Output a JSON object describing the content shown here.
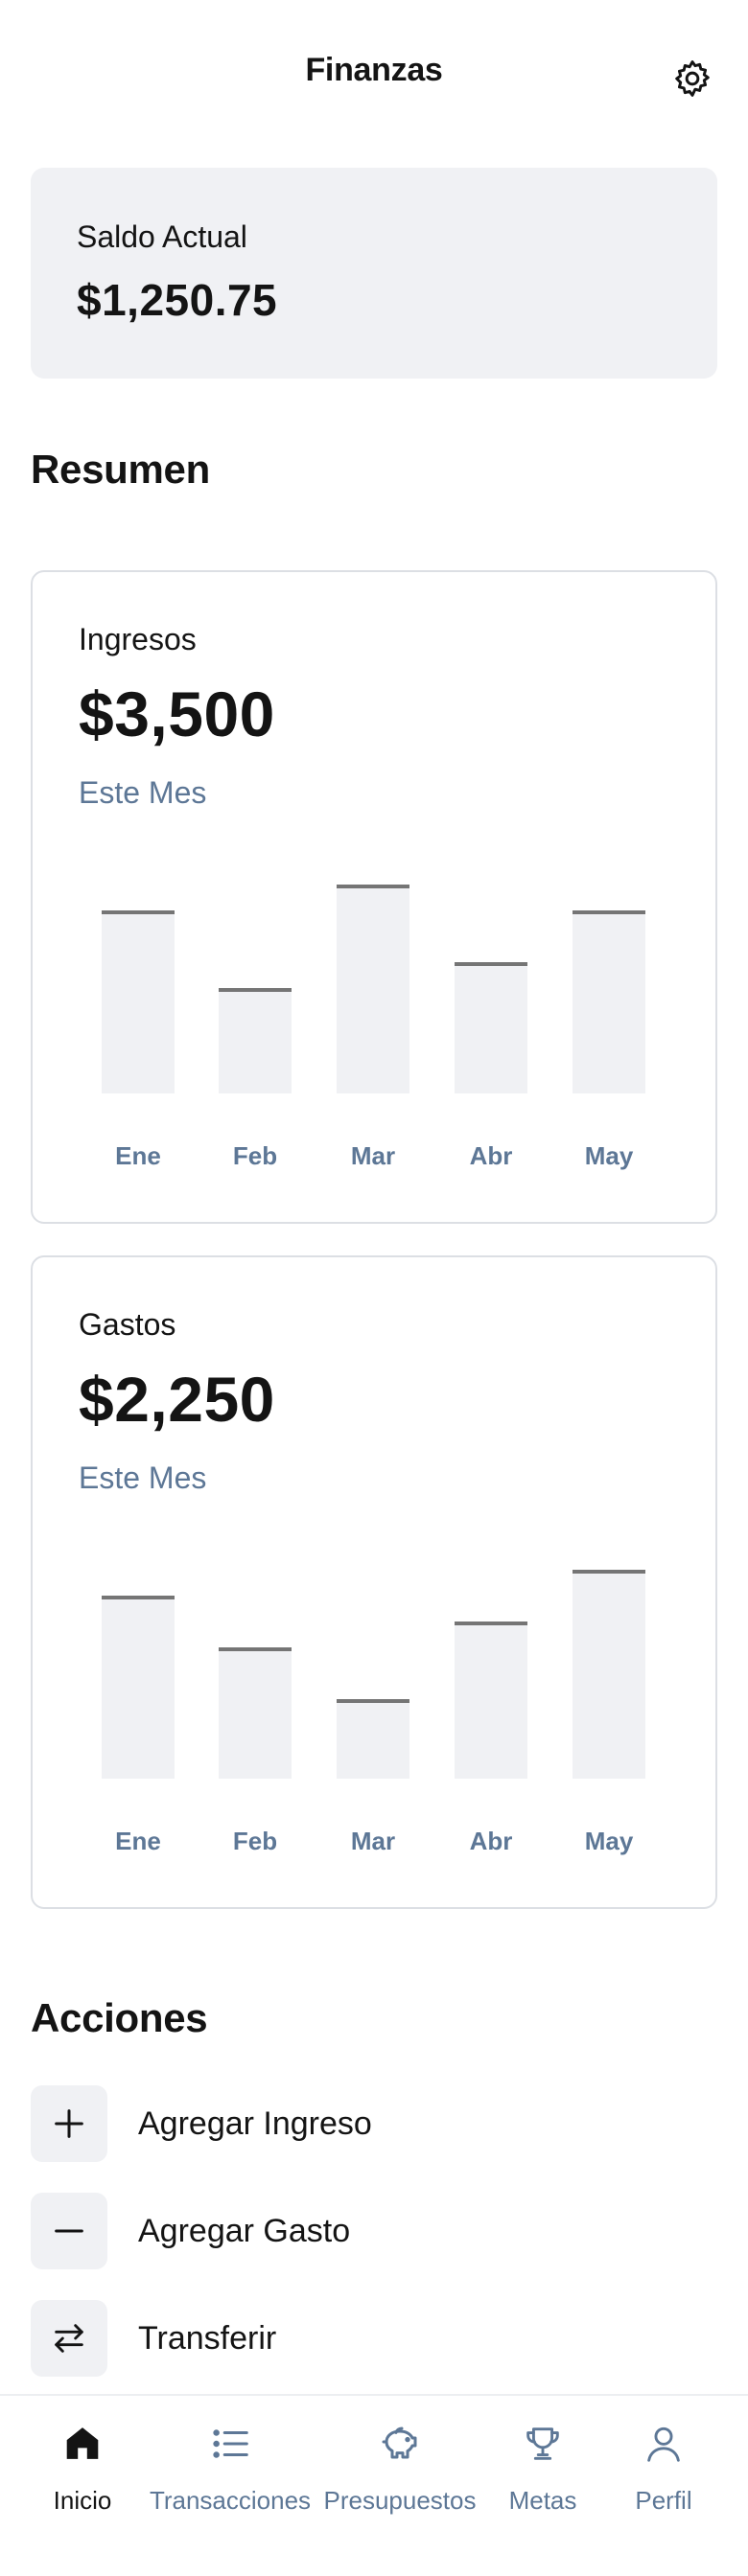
{
  "header": {
    "title": "Finanzas",
    "settings_icon": "gear-icon"
  },
  "balance": {
    "label": "Saldo Actual",
    "value": "$1,250.75"
  },
  "summary": {
    "title": "Resumen"
  },
  "charts": [
    {
      "label": "Ingresos",
      "amount": "$3,500",
      "period": "Este Mes"
    },
    {
      "label": "Gastos",
      "amount": "$2,250",
      "period": "Este Mes"
    }
  ],
  "chart_data": [
    {
      "type": "bar",
      "title": "Ingresos",
      "categories": [
        "Ene",
        "Feb",
        "Mar",
        "Abr",
        "May"
      ],
      "values": [
        70,
        40,
        80,
        50,
        70
      ],
      "ylim": [
        0,
        100
      ],
      "grid": false
    },
    {
      "type": "bar",
      "title": "Gastos",
      "categories": [
        "Ene",
        "Feb",
        "Mar",
        "Abr",
        "May"
      ],
      "values": [
        70,
        50,
        30,
        60,
        80
      ],
      "ylim": [
        0,
        100
      ],
      "grid": false
    }
  ],
  "actions": {
    "title": "Acciones",
    "items": [
      {
        "label": "Agregar Ingreso",
        "icon": "plus-icon"
      },
      {
        "label": "Agregar Gasto",
        "icon": "minus-icon"
      },
      {
        "label": "Transferir",
        "icon": "transfer-arrows-icon"
      }
    ]
  },
  "nav": {
    "active": "Inicio",
    "items": [
      {
        "label": "Inicio",
        "icon": "home-icon"
      },
      {
        "label": "Transacciones",
        "icon": "list-icon"
      },
      {
        "label": "Presupuestos",
        "icon": "piggy-bank-icon"
      },
      {
        "label": "Metas",
        "icon": "trophy-icon"
      },
      {
        "label": "Perfil",
        "icon": "user-icon"
      }
    ]
  },
  "colors": {
    "text": "#141414",
    "muted": "#5d7796",
    "card_bg": "#f0f1f4",
    "bar_fill": "#f0f1f4",
    "bar_top": "#757575",
    "border": "#dcdfe4"
  }
}
